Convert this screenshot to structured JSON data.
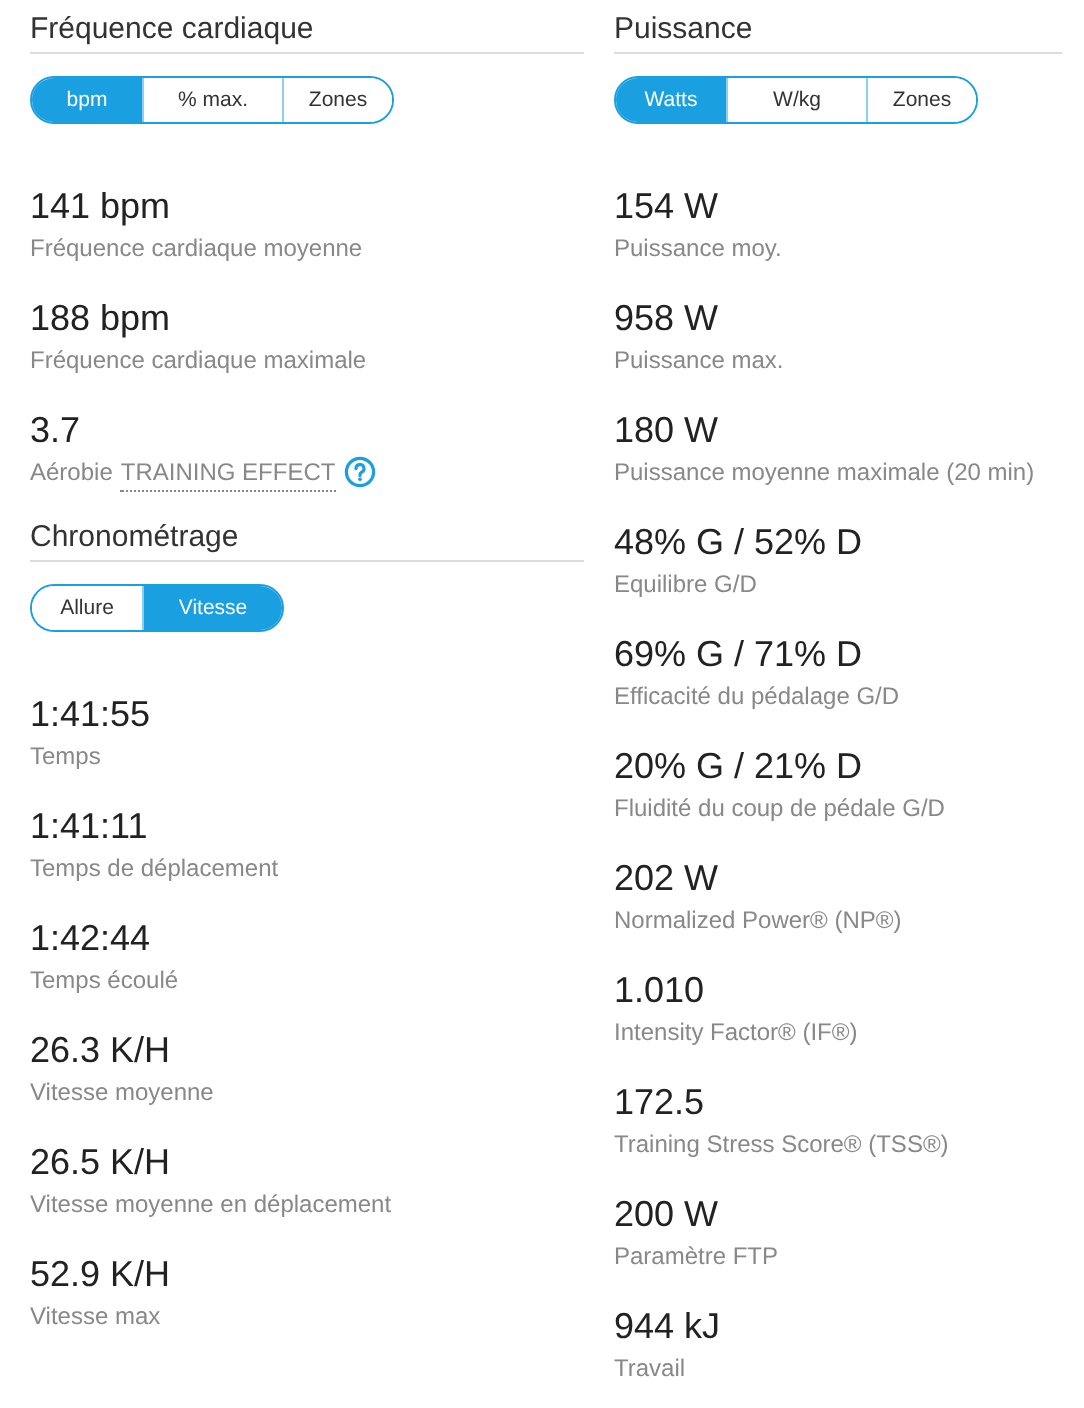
{
  "columns": [
    {
      "sections": [
        {
          "title": "Fréquence cardiaque",
          "toggle": [
            {
              "label": "bpm",
              "selected": true
            },
            {
              "label": "% max.",
              "selected": false
            },
            {
              "label": "Zones",
              "selected": false
            }
          ],
          "stats": [
            {
              "value": "141 bpm",
              "label": "Fréquence cardiaque moyenne"
            },
            {
              "value": "188 bpm",
              "label": "Fréquence cardiaque maximale"
            },
            {
              "value": "3.7",
              "label": "Aérobie",
              "term": "TRAINING EFFECT",
              "help": true
            }
          ]
        },
        {
          "title": "Chronométrage",
          "toggle": [
            {
              "label": "Allure",
              "selected": false
            },
            {
              "label": "Vitesse",
              "selected": true
            }
          ],
          "stats": [
            {
              "value": "1:41:55",
              "label": "Temps"
            },
            {
              "value": "1:41:11",
              "label": "Temps de déplacement"
            },
            {
              "value": "1:42:44",
              "label": "Temps écoulé"
            },
            {
              "value": "26.3 K/H",
              "label": "Vitesse moyenne"
            },
            {
              "value": "26.5 K/H",
              "label": "Vitesse moyenne en déplacement"
            },
            {
              "value": "52.9 K/H",
              "label": "Vitesse max"
            }
          ]
        }
      ]
    },
    {
      "sections": [
        {
          "title": "Puissance",
          "toggle": [
            {
              "label": "Watts",
              "selected": true
            },
            {
              "label": "W/kg",
              "selected": false
            },
            {
              "label": "Zones",
              "selected": false
            }
          ],
          "stats": [
            {
              "value": "154 W",
              "label": "Puissance moy."
            },
            {
              "value": "958 W",
              "label": "Puissance max."
            },
            {
              "value": "180 W",
              "label": "Puissance moyenne maximale (20 min)"
            },
            {
              "value": "48% G / 52% D",
              "label": "Equilibre G/D"
            },
            {
              "value": "69% G / 71% D",
              "label": "Efficacité du pédalage G/D"
            },
            {
              "value": "20% G / 21% D",
              "label": "Fluidité du coup de pédale G/D"
            },
            {
              "value": "202 W",
              "label": "Normalized Power® (NP®)"
            },
            {
              "value": "1.010",
              "label": "Intensity Factor® (IF®)"
            },
            {
              "value": "172.5",
              "label": "Training Stress Score® (TSS®)"
            },
            {
              "value": "200 W",
              "label": "Paramètre FTP"
            },
            {
              "value": "944 kJ",
              "label": "Travail"
            }
          ]
        }
      ]
    }
  ]
}
